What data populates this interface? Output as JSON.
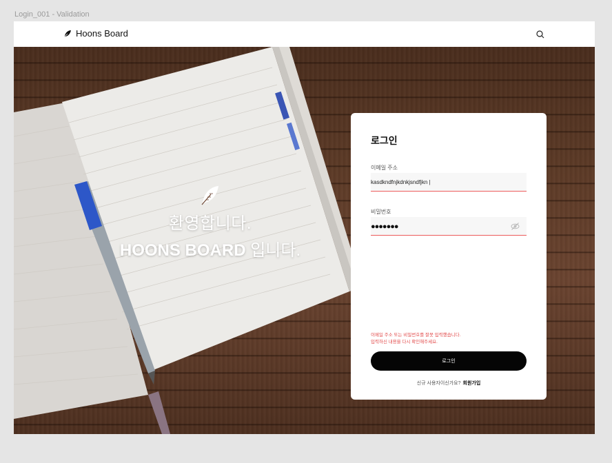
{
  "frame_label": "Login_001 - Validation",
  "navbar": {
    "brand": "Hoons Board",
    "search_icon": "search-icon"
  },
  "hero": {
    "welcome_line1": "환영합니다.",
    "welcome_brand": "HOONS BOARD",
    "welcome_suffix": " 입니다.",
    "feather_icon": "feather-icon"
  },
  "login": {
    "title": "로그인",
    "email_label": "이메일 주소",
    "email_value": "kasdkndfnjkdnkjsndfjkn |",
    "password_label": "비밀번호",
    "password_value": "●●●●●●●",
    "eye_icon": "eye-off-icon",
    "error_line1": "이메일 주소 또는 비밀번호를 잘못 입력했습니다.",
    "error_line2": "입력하신 내용을 다시 확인해주세요.",
    "submit_label": "로그인",
    "signup_prompt": "신규 사용자이신가요?",
    "signup_link": "회원가입"
  },
  "colors": {
    "error": "#e24b4b",
    "button": "#050505",
    "field_bg": "#f7f7f7"
  }
}
